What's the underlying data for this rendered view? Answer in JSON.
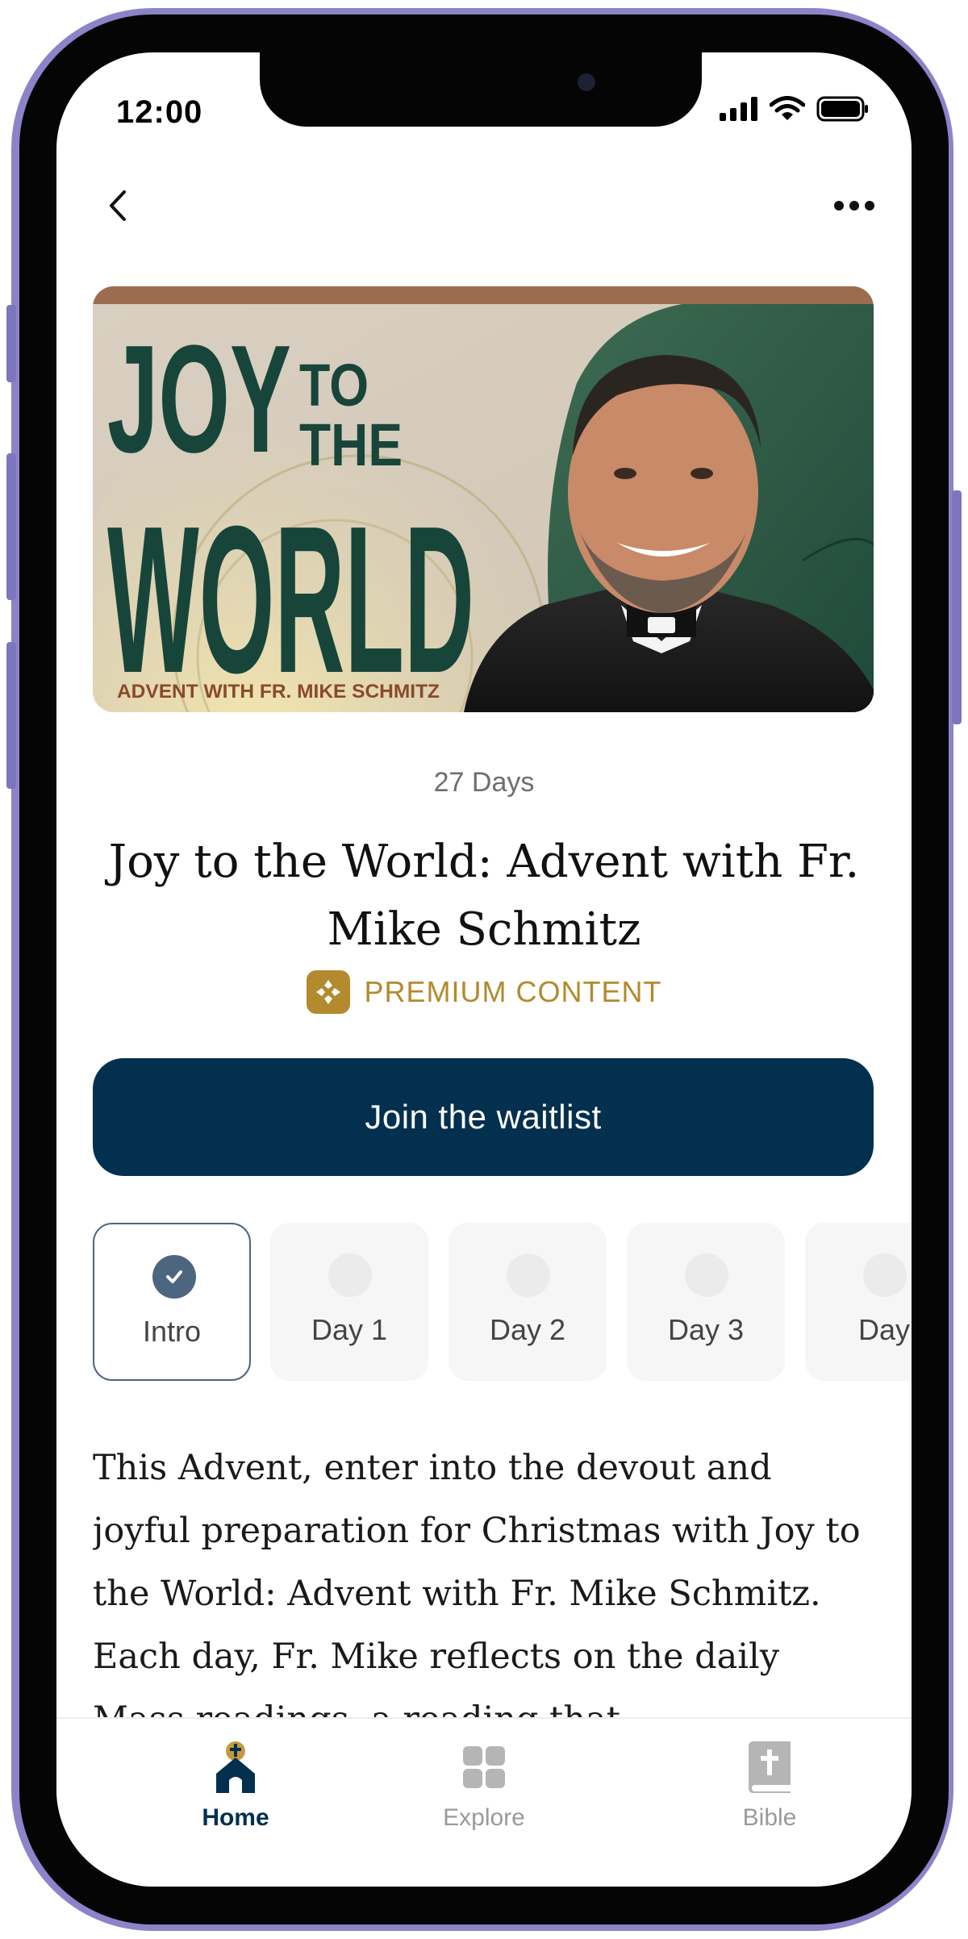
{
  "status_bar": {
    "time": "12:00"
  },
  "hero": {
    "headline_line1": "JOY",
    "headline_to": "TO",
    "headline_the": "THE",
    "headline_line3": "WORLD",
    "tagline": "ADVENT WITH FR. MIKE SCHMITZ"
  },
  "plan": {
    "duration": "27 Days",
    "title": "Joy to the World: Advent with Fr. Mike Schmitz",
    "premium_label": "PREMIUM CONTENT",
    "cta_label": "Join the waitlist"
  },
  "days": [
    {
      "label": "Intro",
      "completed": true
    },
    {
      "label": "Day 1",
      "completed": false
    },
    {
      "label": "Day 2",
      "completed": false
    },
    {
      "label": "Day 3",
      "completed": false
    },
    {
      "label": "Day",
      "completed": false
    }
  ],
  "description": "This Advent, enter into the devout and joyful preparation for Christmas with Joy to the World: Advent with Fr. Mike Schmitz. Each day, Fr. Mike reflects on the daily Mass readings, a reading that",
  "tabs": [
    {
      "label": "Home",
      "icon": "church-icon",
      "active": true
    },
    {
      "label": "Explore",
      "icon": "grid-icon",
      "active": false
    },
    {
      "label": "Bible",
      "icon": "bible-icon",
      "active": false
    }
  ],
  "colors": {
    "primary": "#04304f",
    "premium": "#b38a2d",
    "active_day": "#4c6680",
    "frame": "#8b84c9",
    "hero_green": "#1f4a3a"
  }
}
